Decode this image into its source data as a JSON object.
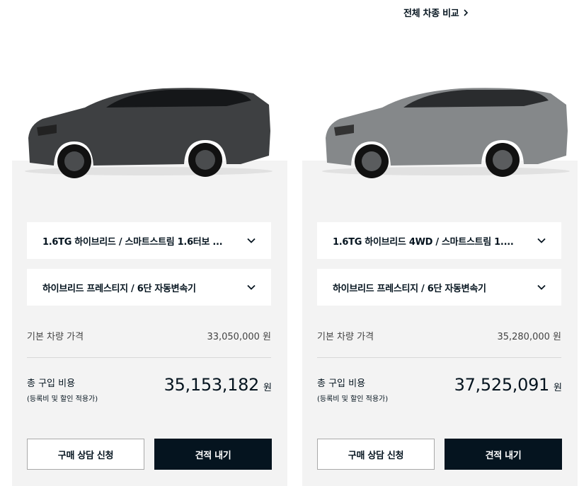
{
  "header": {
    "compare_label": "전체 차종 비교"
  },
  "cards": [
    {
      "trim_select": "1.6TG 하이브리드 / 스마트스트림 1.6터보 ...",
      "grade_select": "하이브리드 프레스티지 / 6단 자동변속기",
      "base_price_label": "기본 차량 가격",
      "base_price": "33,050,000 원",
      "total_label": "총 구입 비용",
      "total_note": "(등록비 및 할인 적용가)",
      "total_price": "35,153,182",
      "total_unit": "원",
      "consult_label": "구매 상담 신청",
      "quote_label": "견적 내기",
      "car_color": "#3e4042"
    },
    {
      "trim_select": "1.6TG 하이브리드 4WD / 스마트스트림 1....",
      "grade_select": "하이브리드 프레스티지 / 6단 자동변속기",
      "base_price_label": "기본 차량 가격",
      "base_price": "35,280,000 원",
      "total_label": "총 구입 비용",
      "total_note": "(등록비 및 할인 적용가)",
      "total_price": "37,525,091",
      "total_unit": "원",
      "consult_label": "구매 상담 신청",
      "quote_label": "견적 내기",
      "car_color": "#85888a"
    }
  ]
}
